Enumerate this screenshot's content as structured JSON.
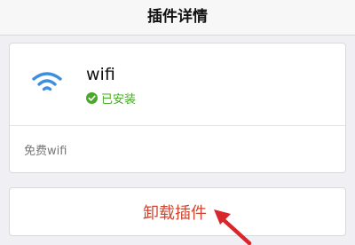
{
  "navbar": {
    "title": "插件详情"
  },
  "plugin": {
    "name": "wifi",
    "status": "已安装",
    "description": "免费wifi",
    "icon": "wifi-icon",
    "status_icon": "check-circle-icon"
  },
  "actions": {
    "uninstall_label": "卸载插件"
  },
  "colors": {
    "wifi_icon": "#3e8ee0",
    "installed_green": "#4aa828",
    "uninstall_red": "#d0452f",
    "annotation_arrow": "#d9262b"
  }
}
